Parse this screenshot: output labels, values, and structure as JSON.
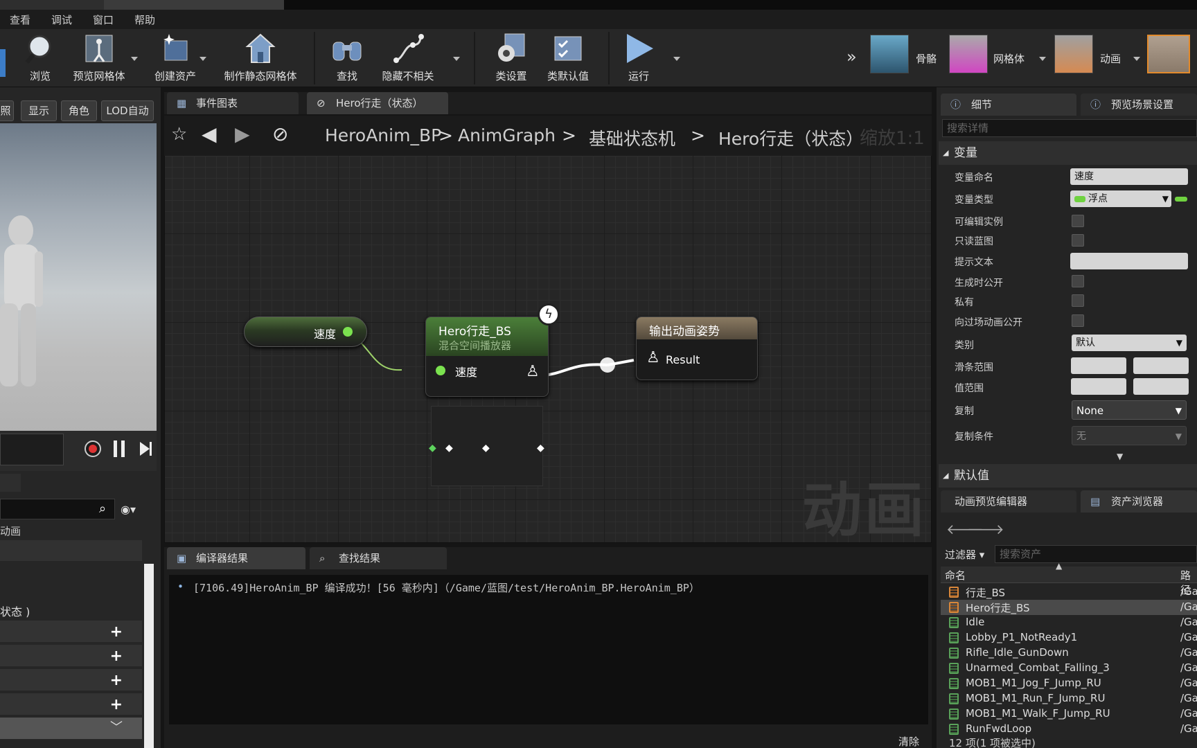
{
  "menu": [
    "查看",
    "调试",
    "窗口",
    "帮助"
  ],
  "toolbar": {
    "browse": "浏览",
    "preview_mesh": "预览网格体",
    "create_asset": "创建资产",
    "make_static_mesh": "制作静态网格体",
    "find": "查找",
    "hide_unrelated": "隐藏不相关",
    "class_settings": "类设置",
    "class_defaults": "类默认值",
    "run": "运行"
  },
  "modes": {
    "skeleton": "骨骼",
    "mesh": "网格体",
    "animation": "动画"
  },
  "viewport": {
    "buttons": [
      "照",
      "显示",
      "角色",
      "LOD自动"
    ]
  },
  "left_tree": {
    "section": "动画",
    "state_item": "状态 )"
  },
  "graph_tabs": [
    {
      "label": "事件图表"
    },
    {
      "label": "Hero行走（状态）"
    }
  ],
  "breadcrumb": [
    "HeroAnim_BP",
    "AnimGraph",
    "基础状态机",
    "Hero行走（状态）"
  ],
  "zoom_label": "缩放1:1",
  "watermark": "动画",
  "nodes": {
    "speed_var": "速度",
    "blendspace_title": "Hero行走_BS",
    "blendspace_subtitle": "混合空间播放器",
    "blendspace_pin": "速度",
    "output_title": "输出动画姿势",
    "output_pin": "Result"
  },
  "bottom_tabs": [
    "编译器结果",
    "查找结果"
  ],
  "log_line": "[7106.49]HeroAnim_BP 编译成功！[56 毫秒内]（/Game/蓝图/test/HeroAnim_BP.HeroAnim_BP）",
  "clear_button": "清除",
  "details": {
    "tabs": [
      "细节",
      "预览场景设置"
    ],
    "search_placeholder": "搜索详情",
    "section_variable": "变量",
    "props": [
      {
        "label": "变量命名",
        "value": "速度"
      },
      {
        "label": "变量类型",
        "value": "浮点"
      },
      {
        "label": "可编辑实例"
      },
      {
        "label": "只读蓝图"
      },
      {
        "label": "提示文本",
        "value": ""
      },
      {
        "label": "生成时公开"
      },
      {
        "label": "私有"
      },
      {
        "label": "向过场动画公开"
      },
      {
        "label": "类别",
        "value": "默认"
      },
      {
        "label": "滑条范围"
      },
      {
        "label": "值范围"
      },
      {
        "label": "复制",
        "value": "None"
      },
      {
        "label": "复制条件",
        "value": "无"
      }
    ],
    "section_default": "默认值"
  },
  "asset_browser": {
    "tabs": [
      "动画预览编辑器",
      "资产浏览器"
    ],
    "filter": "过滤器",
    "search_placeholder": "搜索资产",
    "col_name": "命名",
    "col_path": "路径",
    "items": [
      "行走_BS",
      "Hero行走_BS",
      "Idle",
      "Lobby_P1_NotReady1",
      "Rifle_Idle_GunDown",
      "Unarmed_Combat_Falling_3",
      "MOB1_M1_Jog_F_Jump_RU",
      "MOB1_M1_Run_F_Jump_RU",
      "MOB1_M1_Walk_F_Jump_RU",
      "RunFwdLoop"
    ],
    "path_prefix": "/Ga",
    "status": "12 项(1 项被选中)"
  },
  "colors": {
    "pin_green": "#7be24f",
    "node_green": "#3e6b2e",
    "selected_row": "#4a4a4a"
  }
}
